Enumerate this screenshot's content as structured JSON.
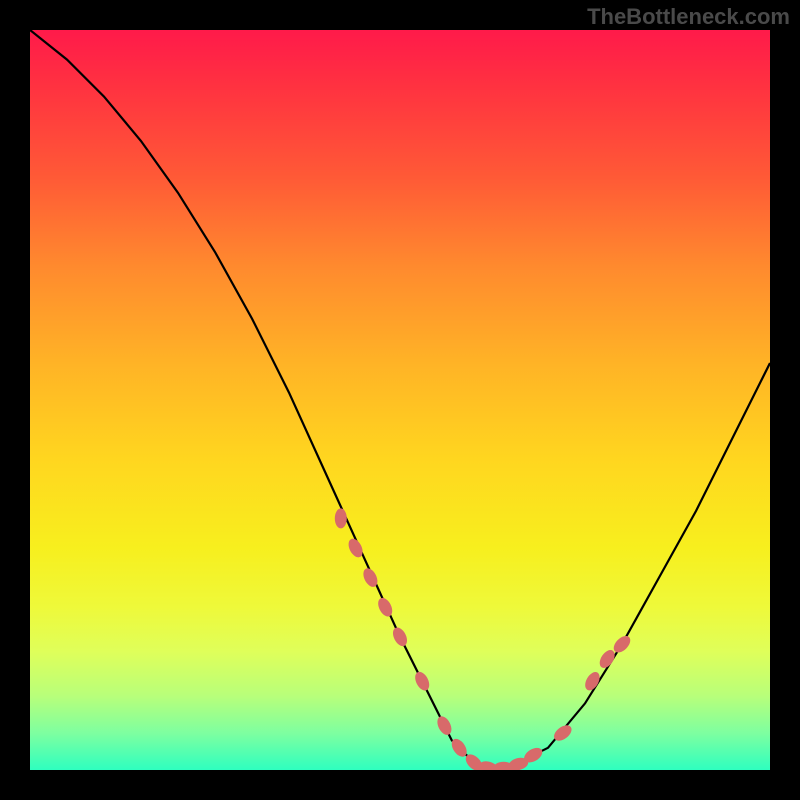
{
  "watermark": "TheBottleneck.com",
  "chart_data": {
    "type": "line",
    "title": "",
    "xlabel": "",
    "ylabel": "",
    "xlim": [
      0,
      100
    ],
    "ylim": [
      0,
      100
    ],
    "series": [
      {
        "name": "curve",
        "x": [
          0,
          5,
          10,
          15,
          20,
          25,
          30,
          35,
          40,
          45,
          50,
          55,
          57,
          60,
          63,
          65,
          70,
          75,
          80,
          85,
          90,
          95,
          100
        ],
        "values": [
          100,
          96,
          91,
          85,
          78,
          70,
          61,
          51,
          40,
          29,
          18,
          8,
          4,
          1,
          0.2,
          0.5,
          3,
          9,
          17,
          26,
          35,
          45,
          55
        ]
      }
    ],
    "markers": {
      "x": [
        42,
        44,
        46,
        48,
        50,
        53,
        56,
        58,
        60,
        62,
        64,
        66,
        68,
        72,
        76,
        78,
        80
      ],
      "values": [
        34,
        30,
        26,
        22,
        18,
        12,
        6,
        3,
        1,
        0.3,
        0.3,
        0.8,
        2,
        5,
        12,
        15,
        17
      ]
    },
    "background_gradient": {
      "stops": [
        {
          "pos": 0,
          "color": "#ff1a4a"
        },
        {
          "pos": 20,
          "color": "#ff5a36"
        },
        {
          "pos": 45,
          "color": "#ffb326"
        },
        {
          "pos": 70,
          "color": "#f7ef1e"
        },
        {
          "pos": 90,
          "color": "#b8ff7a"
        },
        {
          "pos": 100,
          "color": "#2effbf"
        }
      ]
    }
  }
}
